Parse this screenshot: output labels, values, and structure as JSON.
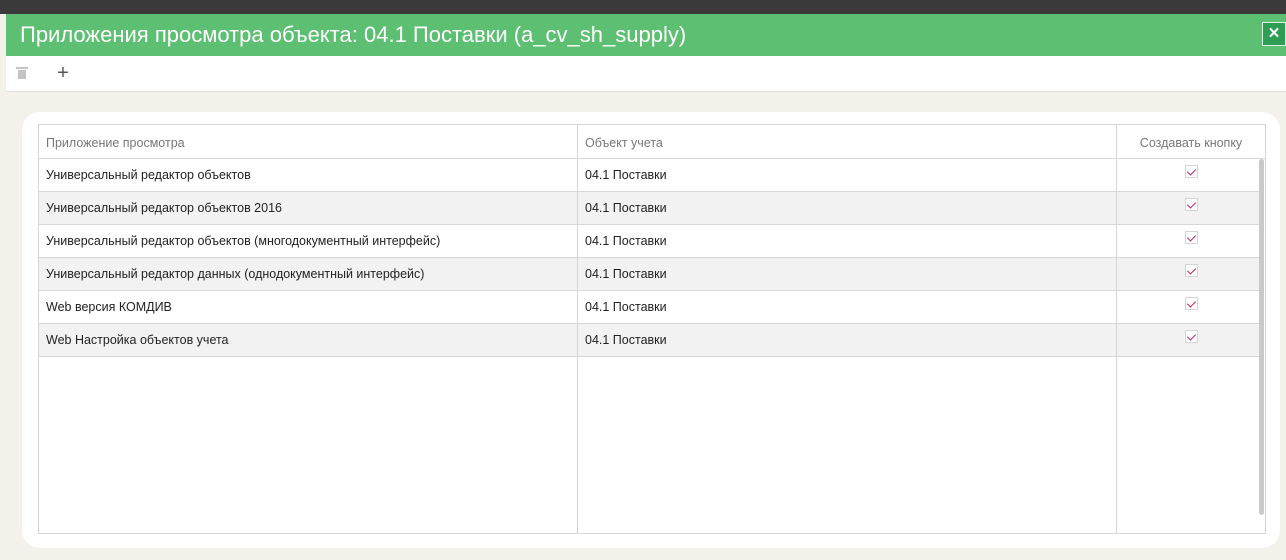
{
  "window": {
    "title": "Приложения просмотра объекта: 04.1 Поставки (a_cv_sh_supply)",
    "close_icon": "close-icon"
  },
  "toolbar": {
    "delete_icon": "trash-icon",
    "add_icon": "plus-icon",
    "add_glyph": "+"
  },
  "table": {
    "columns": [
      "Приложение просмотра",
      "Объект учета",
      "Создавать кнопку"
    ],
    "rows": [
      {
        "app": "Универсальный редактор объектов",
        "object": "04.1 Поставки",
        "create_button": true
      },
      {
        "app": "Универсальный редактор объектов 2016",
        "object": "04.1 Поставки",
        "create_button": true
      },
      {
        "app": "Универсальный редактор объектов (многодокументный интерфейс)",
        "object": "04.1 Поставки",
        "create_button": true
      },
      {
        "app": "Универсальный редактор данных (однодокументный интерфейс)",
        "object": "04.1 Поставки",
        "create_button": true
      },
      {
        "app": "Web версия КОМДИВ",
        "object": "04.1 Поставки",
        "create_button": true
      },
      {
        "app": "Web Настройка объектов учета",
        "object": "04.1 Поставки",
        "create_button": true
      }
    ]
  },
  "colors": {
    "titlebar": "#5cbf72",
    "check": "#c0266a",
    "background": "#f3f1ea"
  }
}
